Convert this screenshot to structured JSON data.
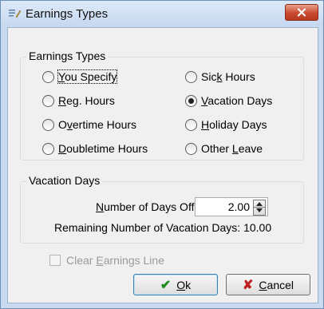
{
  "window": {
    "title": "Earnings Types"
  },
  "earnings_group": {
    "title": "Earnings Types",
    "options": [
      {
        "label_pre": "",
        "accel": "Y",
        "label_post": "ou Specify",
        "selected": false
      },
      {
        "label_pre": "",
        "accel": "R",
        "label_post": "eg. Hours",
        "selected": false
      },
      {
        "label_pre": "O",
        "accel": "v",
        "label_post": "ertime Hours",
        "selected": false
      },
      {
        "label_pre": "",
        "accel": "D",
        "label_post": "oubletime Hours",
        "selected": false
      },
      {
        "label_pre": "Sic",
        "accel": "k",
        "label_post": " Hours",
        "selected": false
      },
      {
        "label_pre": "",
        "accel": "V",
        "label_post": "acation Days",
        "selected": true
      },
      {
        "label_pre": "",
        "accel": "H",
        "label_post": "oliday Days",
        "selected": false
      },
      {
        "label_pre": "Other ",
        "accel": "L",
        "label_post": "eave",
        "selected": false
      }
    ]
  },
  "vacation_group": {
    "title": "Vacation Days",
    "days_off_label_accel": "N",
    "days_off_label_rest": "umber of Days Off",
    "days_off_value": "2.00",
    "remaining_label": "Remaining Number of Vacation Days: 10.00"
  },
  "clear_line": {
    "label_pre": "Clear ",
    "accel": "E",
    "label_post": "arnings Line",
    "checked": false,
    "enabled": false
  },
  "buttons": {
    "ok": {
      "accel": "O",
      "rest": "k"
    },
    "cancel": {
      "accel": "C",
      "rest": "ancel"
    }
  },
  "colors": {
    "accent_check": "#1f8a1f",
    "accent_x": "#c02020",
    "close_red": "#c94a2e"
  }
}
